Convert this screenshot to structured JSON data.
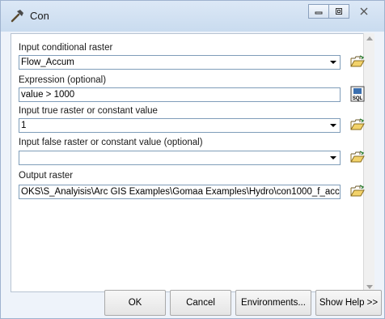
{
  "window": {
    "title": "Con"
  },
  "form": {
    "input_raster_label": "Input conditional raster",
    "input_raster_value": "Flow_Accum",
    "expression_label": "Expression (optional)",
    "expression_value": "value > 1000",
    "sql_button_label": "SQL",
    "true_label": "Input true raster or constant value",
    "true_value": "1",
    "false_label": "Input false raster or constant value (optional)",
    "false_value": "",
    "output_label": "Output raster",
    "output_value": "OKS\\S_Analyisis\\Arc GIS Examples\\Gomaa Examples\\Hydro\\con1000_f_acc"
  },
  "buttons": {
    "ok": "OK",
    "cancel": "Cancel",
    "environments": "Environments...",
    "show_help": "Show Help >>"
  },
  "icons": {
    "title": "hammer-icon",
    "browse": "open-folder-icon",
    "sql": "sql-query-icon"
  },
  "colors": {
    "titlebar": "#c9dbef",
    "panel": "#ffffff",
    "field_border": "#7f9db9"
  }
}
